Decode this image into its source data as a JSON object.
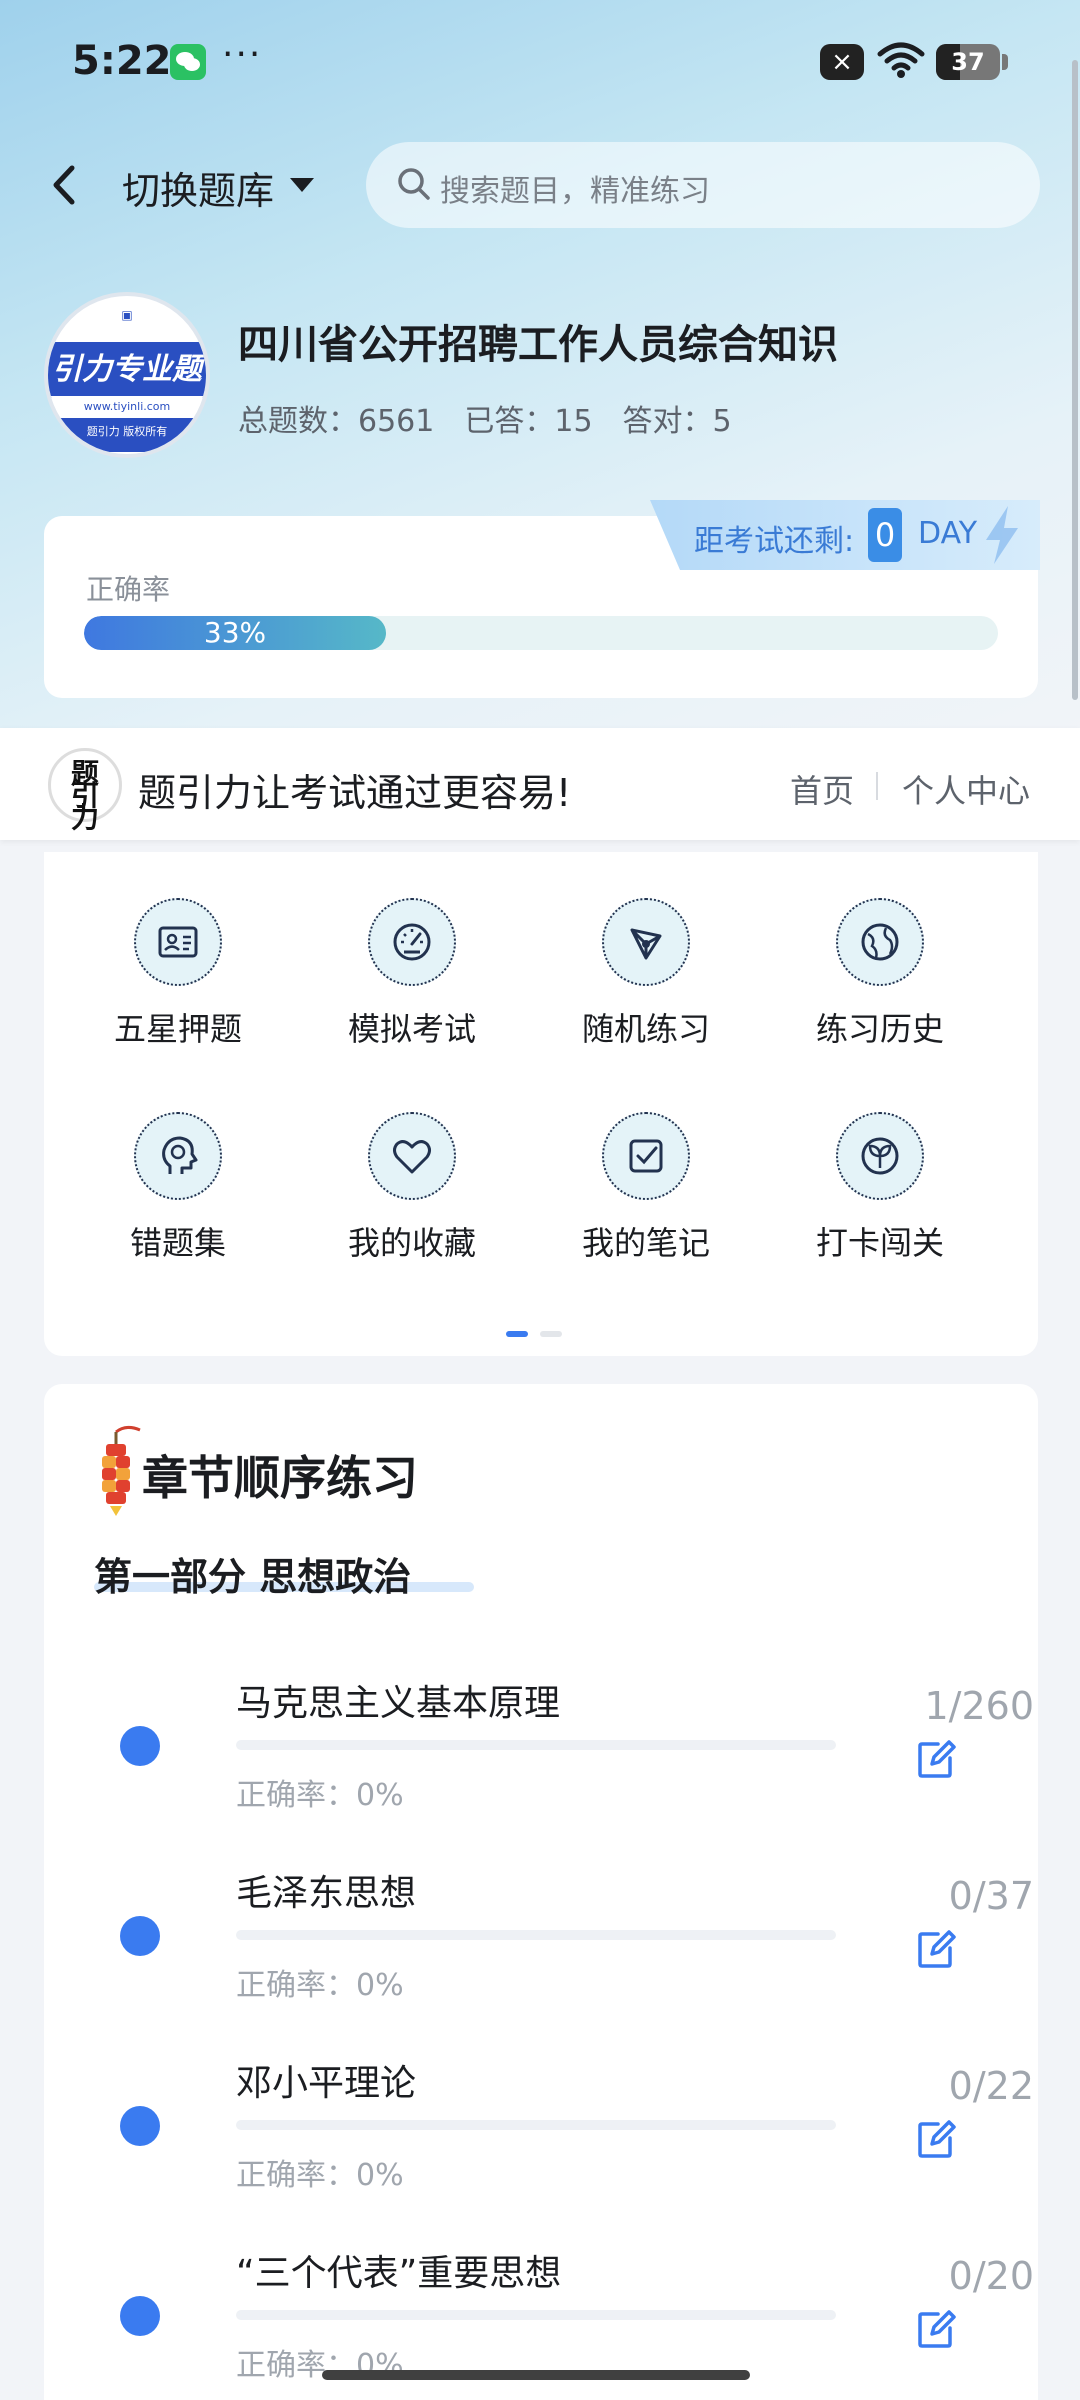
{
  "status": {
    "time": "5:22",
    "dots": "···",
    "battery": "37",
    "battery_level": 0.37
  },
  "nav": {
    "switch_label": "切换题库",
    "search_placeholder": "搜索题目，精准练习"
  },
  "bank": {
    "logo_text": "引力专业题",
    "logo_url": "www.tiyinli.com",
    "logo_sub": "题引力 版权所有",
    "title": "四川省公开招聘工作人员综合知识",
    "total_label": "总题数：6561",
    "answered_label": "已答：15",
    "correct_label": "答对：5"
  },
  "countdown": {
    "label": "距考试还剩:",
    "days": "0",
    "unit": "DAY"
  },
  "accuracy": {
    "label": "正确率",
    "value_text": "33%",
    "value": 0.33
  },
  "brand_bar": {
    "logo_text": "题引力",
    "slogan": "题引力让考试通过更容易!",
    "home": "首页",
    "me": "个人中心"
  },
  "grid": [
    {
      "label": "五星押题",
      "icon": "id-card-icon"
    },
    {
      "label": "模拟考试",
      "icon": "gauge-icon"
    },
    {
      "label": "随机练习",
      "icon": "network-icon"
    },
    {
      "label": "练习历史",
      "icon": "globe-icon"
    },
    {
      "label": "错题集",
      "icon": "head-icon"
    },
    {
      "label": "我的收藏",
      "icon": "heart-icon"
    },
    {
      "label": "我的笔记",
      "icon": "note-check-icon"
    },
    {
      "label": "打卡闯关",
      "icon": "sprout-icon"
    }
  ],
  "chapters": {
    "title": "章节顺序练习",
    "part_title": "第一部分  思想政治",
    "items": [
      {
        "name": "马克思主义基本原理",
        "rate": "正确率：0%",
        "count": "1/260"
      },
      {
        "name": "毛泽东思想",
        "rate": "正确率：0%",
        "count": "0/37"
      },
      {
        "name": "邓小平理论",
        "rate": "正确率：0%",
        "count": "0/22"
      },
      {
        "name": "“三个代表”重要思想",
        "rate": "正确率：0%",
        "count": "0/20"
      }
    ]
  },
  "colors": {
    "accent": "#3a7bf0",
    "accent_light": "#d7e8fb"
  }
}
